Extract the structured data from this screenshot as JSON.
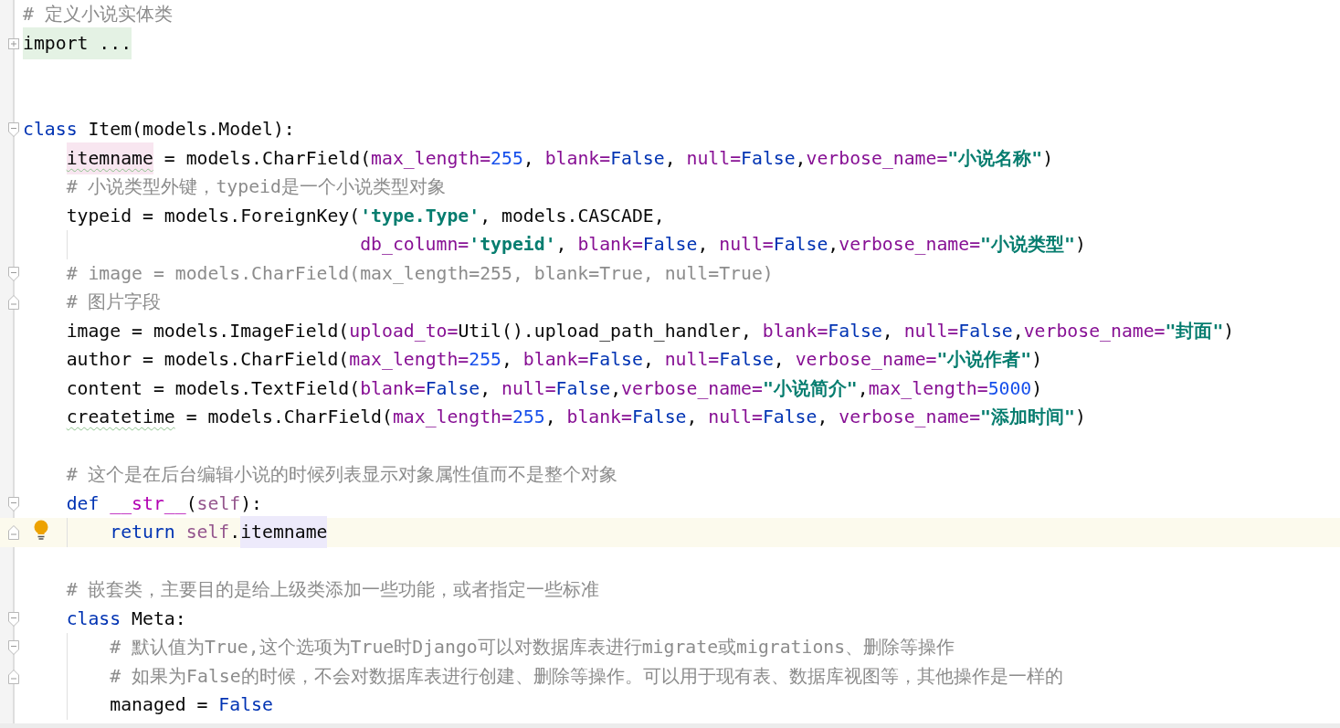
{
  "editor": {
    "lines": [
      {
        "kind": "code",
        "current": false,
        "tokens": [
          {
            "kind": "comment",
            "text": "# 定义小说实体类"
          }
        ]
      },
      {
        "kind": "code",
        "current": false,
        "gutter": [
          {
            "kind": "folded"
          }
        ],
        "tokens": [
          {
            "kind": "folded",
            "text": "import ..."
          }
        ]
      },
      {
        "kind": "blank",
        "current": false
      },
      {
        "kind": "blank",
        "current": false
      },
      {
        "kind": "code",
        "current": false,
        "gutter": [
          {
            "kind": "fold-start"
          }
        ],
        "tokens": [
          {
            "kind": "keyword",
            "text": "class"
          },
          {
            "kind": "plain",
            "text": " Item(models.Model):"
          }
        ],
        "children": [
          {
            "kind": "code",
            "current": false,
            "tokens": [
              {
                "kind": "declaration",
                "text": "itemname"
              },
              {
                "kind": "plain",
                "text": " = models.CharField("
              },
              {
                "kind": "param",
                "text": "max_length="
              },
              {
                "kind": "number",
                "text": "255"
              },
              {
                "kind": "plain",
                "text": ", "
              },
              {
                "kind": "param",
                "text": "blank="
              },
              {
                "kind": "keyword",
                "text": "False"
              },
              {
                "kind": "plain",
                "text": ", "
              },
              {
                "kind": "param",
                "text": "null="
              },
              {
                "kind": "keyword",
                "text": "False"
              },
              {
                "kind": "plain",
                "text": ","
              },
              {
                "kind": "param",
                "text": "verbose_name="
              },
              {
                "kind": "string",
                "text": "\"小说名称\""
              },
              {
                "kind": "plain",
                "text": ")"
              }
            ]
          },
          {
            "kind": "code",
            "current": false,
            "tokens": [
              {
                "kind": "comment",
                "text": "# 小说类型外键，typeid是一个小说类型对象"
              }
            ]
          },
          {
            "kind": "code",
            "current": false,
            "tokens": [
              {
                "kind": "plain",
                "text": "typeid = models.ForeignKey("
              },
              {
                "kind": "string",
                "text": "'type.Type'"
              },
              {
                "kind": "plain",
                "text": ", models.CASCADE,"
              }
            ],
            "children": [
              {
                "kind": "code",
                "current": false,
                "tokens": [
                  {
                    "kind": "param",
                    "text": "                       db_column="
                  },
                  {
                    "kind": "string",
                    "text": "'typeid'"
                  },
                  {
                    "kind": "plain",
                    "text": ", "
                  },
                  {
                    "kind": "param",
                    "text": "blank="
                  },
                  {
                    "kind": "keyword",
                    "text": "False"
                  },
                  {
                    "kind": "plain",
                    "text": ", "
                  },
                  {
                    "kind": "param",
                    "text": "null="
                  },
                  {
                    "kind": "keyword",
                    "text": "False"
                  },
                  {
                    "kind": "plain",
                    "text": ","
                  },
                  {
                    "kind": "param",
                    "text": "verbose_name="
                  },
                  {
                    "kind": "string",
                    "text": "\"小说类型\""
                  },
                  {
                    "kind": "plain",
                    "text": ")"
                  }
                ]
              }
            ]
          },
          {
            "kind": "code",
            "current": false,
            "gutter": [
              {
                "kind": "fold-start"
              }
            ],
            "tokens": [
              {
                "kind": "comment",
                "text": "# image = models.CharField(max_length=255, blank=True, null=True)"
              }
            ]
          },
          {
            "kind": "code",
            "current": false,
            "gutter": [
              {
                "kind": "fold-end"
              }
            ],
            "tokens": [
              {
                "kind": "comment",
                "text": "# 图片字段"
              }
            ]
          },
          {
            "kind": "code",
            "current": false,
            "tokens": [
              {
                "kind": "plain",
                "text": "image = models.ImageField("
              },
              {
                "kind": "param",
                "text": "upload_to="
              },
              {
                "kind": "plain",
                "text": "Util().upload_path_handler, "
              },
              {
                "kind": "param",
                "text": "blank="
              },
              {
                "kind": "keyword",
                "text": "False"
              },
              {
                "kind": "plain",
                "text": ", "
              },
              {
                "kind": "param",
                "text": "null="
              },
              {
                "kind": "keyword",
                "text": "False"
              },
              {
                "kind": "plain",
                "text": ","
              },
              {
                "kind": "param",
                "text": "verbose_name="
              },
              {
                "kind": "string",
                "text": "\"封面\""
              },
              {
                "kind": "plain",
                "text": ")"
              }
            ]
          },
          {
            "kind": "code",
            "current": false,
            "tokens": [
              {
                "kind": "plain",
                "text": "author = models.CharField("
              },
              {
                "kind": "param",
                "text": "max_length="
              },
              {
                "kind": "number",
                "text": "255"
              },
              {
                "kind": "plain",
                "text": ", "
              },
              {
                "kind": "param",
                "text": "blank="
              },
              {
                "kind": "keyword",
                "text": "False"
              },
              {
                "kind": "plain",
                "text": ", "
              },
              {
                "kind": "param",
                "text": "null="
              },
              {
                "kind": "keyword",
                "text": "False"
              },
              {
                "kind": "plain",
                "text": ", "
              },
              {
                "kind": "param",
                "text": "verbose_name="
              },
              {
                "kind": "string",
                "text": "\"小说作者\""
              },
              {
                "kind": "plain",
                "text": ")"
              }
            ]
          },
          {
            "kind": "code",
            "current": false,
            "tokens": [
              {
                "kind": "plain",
                "text": "content = models.TextField("
              },
              {
                "kind": "param",
                "text": "blank="
              },
              {
                "kind": "keyword",
                "text": "False"
              },
              {
                "kind": "plain",
                "text": ", "
              },
              {
                "kind": "param",
                "text": "null="
              },
              {
                "kind": "keyword",
                "text": "False"
              },
              {
                "kind": "plain",
                "text": ","
              },
              {
                "kind": "param",
                "text": "verbose_name="
              },
              {
                "kind": "string",
                "text": "\"小说简介\""
              },
              {
                "kind": "plain",
                "text": ","
              },
              {
                "kind": "param",
                "text": "max_length="
              },
              {
                "kind": "number",
                "text": "5000"
              },
              {
                "kind": "plain",
                "text": ")"
              }
            ]
          },
          {
            "kind": "code",
            "current": false,
            "tokens": [
              {
                "kind": "typo",
                "text": "createtime"
              },
              {
                "kind": "plain",
                "text": " = models.CharField("
              },
              {
                "kind": "param",
                "text": "max_length="
              },
              {
                "kind": "number",
                "text": "255"
              },
              {
                "kind": "plain",
                "text": ", "
              },
              {
                "kind": "param",
                "text": "blank="
              },
              {
                "kind": "keyword",
                "text": "False"
              },
              {
                "kind": "plain",
                "text": ", "
              },
              {
                "kind": "param",
                "text": "null="
              },
              {
                "kind": "keyword",
                "text": "False"
              },
              {
                "kind": "plain",
                "text": ", "
              },
              {
                "kind": "param",
                "text": "verbose_name="
              },
              {
                "kind": "string",
                "text": "\"添加时间\""
              },
              {
                "kind": "plain",
                "text": ")"
              }
            ]
          },
          {
            "kind": "blank",
            "current": false
          },
          {
            "kind": "code",
            "current": false,
            "tokens": [
              {
                "kind": "comment",
                "text": "# 这个是在后台编辑小说的时候列表显示对象属性值而不是整个对象"
              }
            ]
          },
          {
            "kind": "code",
            "current": false,
            "gutter": [
              {
                "kind": "fold-start"
              }
            ],
            "tokens": [
              {
                "kind": "keyword",
                "text": "def "
              },
              {
                "kind": "magic",
                "text": "__str__"
              },
              {
                "kind": "plain",
                "text": "("
              },
              {
                "kind": "self",
                "text": "self"
              },
              {
                "kind": "plain",
                "text": "):"
              }
            ],
            "children": [
              {
                "kind": "code",
                "current": true,
                "gutter": [
                  {
                    "kind": "fold-end"
                  },
                  {
                    "kind": "bulb"
                  }
                ],
                "tokens": [
                  {
                    "kind": "keyword",
                    "text": "return "
                  },
                  {
                    "kind": "self",
                    "text": "self"
                  },
                  {
                    "kind": "plain",
                    "text": "."
                  },
                  {
                    "kind": "usage",
                    "text": "itemname"
                  }
                ]
              }
            ]
          },
          {
            "kind": "blank",
            "current": false
          },
          {
            "kind": "code",
            "current": false,
            "tokens": [
              {
                "kind": "comment",
                "text": "# 嵌套类，主要目的是给上级类添加一些功能，或者指定一些标准"
              }
            ]
          },
          {
            "kind": "code",
            "current": false,
            "gutter": [
              {
                "kind": "fold-start"
              }
            ],
            "tokens": [
              {
                "kind": "keyword",
                "text": "class"
              },
              {
                "kind": "plain",
                "text": " Meta:"
              }
            ],
            "children": [
              {
                "kind": "code",
                "current": false,
                "gutter": [
                  {
                    "kind": "fold-start"
                  }
                ],
                "tokens": [
                  {
                    "kind": "comment",
                    "text": "# 默认值为True,这个选项为True时Django可以对数据库表进行migrate或migrations、删除等操作"
                  }
                ]
              },
              {
                "kind": "code",
                "current": false,
                "gutter": [
                  {
                    "kind": "fold-end"
                  }
                ],
                "tokens": [
                  {
                    "kind": "comment",
                    "text": "# 如果为False的时候，不会对数据库表进行创建、删除等操作。可以用于现有表、数据库视图等，其他操作是一样的"
                  }
                ]
              },
              {
                "kind": "code",
                "current": false,
                "tokens": [
                  {
                    "kind": "plain",
                    "text": "managed = "
                  },
                  {
                    "kind": "keyword",
                    "text": "False"
                  }
                ]
              }
            ]
          }
        ]
      }
    ]
  }
}
